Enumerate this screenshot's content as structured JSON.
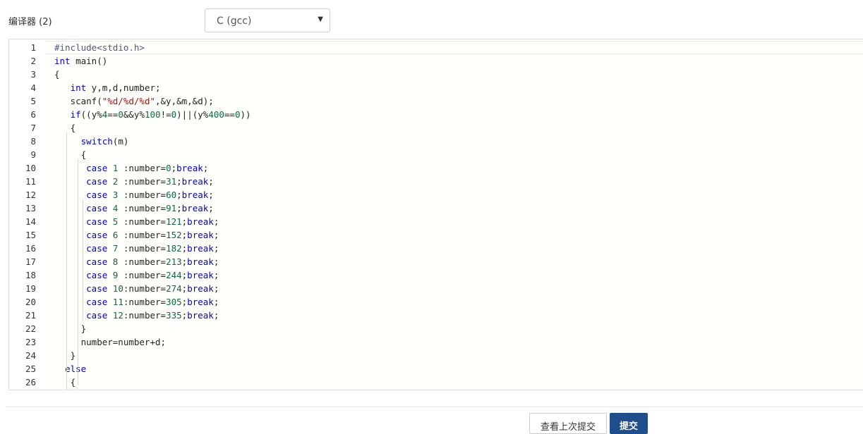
{
  "compiler": {
    "label": "编译器 (2)",
    "selected": "C (gcc)",
    "caret_icon": "triangle-down-icon"
  },
  "editor": {
    "lines": [
      {
        "n": "1",
        "tokens": [
          {
            "t": "#include<stdio.h>",
            "c": "meta"
          }
        ]
      },
      {
        "n": "2",
        "tokens": [
          {
            "t": "int",
            "c": "kw"
          },
          {
            "t": " main()",
            "c": ""
          }
        ]
      },
      {
        "n": "3",
        "tokens": [
          {
            "t": "{",
            "c": ""
          }
        ]
      },
      {
        "n": "4",
        "tokens": [
          {
            "t": "   ",
            "c": ""
          },
          {
            "t": "int",
            "c": "kw"
          },
          {
            "t": " y,m,d,number;",
            "c": ""
          }
        ]
      },
      {
        "n": "5",
        "tokens": [
          {
            "t": "   scanf(",
            "c": ""
          },
          {
            "t": "\"%d/%d/%d\"",
            "c": "str"
          },
          {
            "t": ",&y,&m,&d);",
            "c": ""
          }
        ]
      },
      {
        "n": "6",
        "tokens": [
          {
            "t": "   ",
            "c": ""
          },
          {
            "t": "if",
            "c": "kw"
          },
          {
            "t": "((y%",
            "c": ""
          },
          {
            "t": "4",
            "c": "num"
          },
          {
            "t": "==",
            "c": ""
          },
          {
            "t": "0",
            "c": "num"
          },
          {
            "t": "&&y%",
            "c": ""
          },
          {
            "t": "100",
            "c": "num"
          },
          {
            "t": "!=",
            "c": ""
          },
          {
            "t": "0",
            "c": "num"
          },
          {
            "t": ")||(y%",
            "c": ""
          },
          {
            "t": "400",
            "c": "num"
          },
          {
            "t": "==",
            "c": ""
          },
          {
            "t": "0",
            "c": "num"
          },
          {
            "t": "))",
            "c": ""
          }
        ]
      },
      {
        "n": "7",
        "tokens": [
          {
            "t": "   {",
            "c": ""
          }
        ]
      },
      {
        "n": "8",
        "tokens": [
          {
            "t": "     ",
            "c": ""
          },
          {
            "t": "switch",
            "c": "kw"
          },
          {
            "t": "(m)",
            "c": ""
          }
        ]
      },
      {
        "n": "9",
        "tokens": [
          {
            "t": "     {",
            "c": ""
          }
        ]
      },
      {
        "n": "10",
        "tokens": [
          {
            "t": "      ",
            "c": ""
          },
          {
            "t": "case",
            "c": "kw"
          },
          {
            "t": " ",
            "c": ""
          },
          {
            "t": "1",
            "c": "num"
          },
          {
            "t": " :number=",
            "c": ""
          },
          {
            "t": "0",
            "c": "num"
          },
          {
            "t": ";",
            "c": ""
          },
          {
            "t": "break",
            "c": "kw"
          },
          {
            "t": ";",
            "c": ""
          }
        ]
      },
      {
        "n": "11",
        "tokens": [
          {
            "t": "      ",
            "c": ""
          },
          {
            "t": "case",
            "c": "kw"
          },
          {
            "t": " ",
            "c": ""
          },
          {
            "t": "2",
            "c": "num"
          },
          {
            "t": " :number=",
            "c": ""
          },
          {
            "t": "31",
            "c": "num"
          },
          {
            "t": ";",
            "c": ""
          },
          {
            "t": "break",
            "c": "kw"
          },
          {
            "t": ";",
            "c": ""
          }
        ]
      },
      {
        "n": "12",
        "tokens": [
          {
            "t": "      ",
            "c": ""
          },
          {
            "t": "case",
            "c": "kw"
          },
          {
            "t": " ",
            "c": ""
          },
          {
            "t": "3",
            "c": "num"
          },
          {
            "t": " :number=",
            "c": ""
          },
          {
            "t": "60",
            "c": "num"
          },
          {
            "t": ";",
            "c": ""
          },
          {
            "t": "break",
            "c": "kw"
          },
          {
            "t": ";",
            "c": ""
          }
        ]
      },
      {
        "n": "13",
        "tokens": [
          {
            "t": "      ",
            "c": ""
          },
          {
            "t": "case",
            "c": "kw"
          },
          {
            "t": " ",
            "c": ""
          },
          {
            "t": "4",
            "c": "num"
          },
          {
            "t": " :number=",
            "c": ""
          },
          {
            "t": "91",
            "c": "num"
          },
          {
            "t": ";",
            "c": ""
          },
          {
            "t": "break",
            "c": "kw"
          },
          {
            "t": ";",
            "c": ""
          }
        ]
      },
      {
        "n": "14",
        "tokens": [
          {
            "t": "      ",
            "c": ""
          },
          {
            "t": "case",
            "c": "kw"
          },
          {
            "t": " ",
            "c": ""
          },
          {
            "t": "5",
            "c": "num"
          },
          {
            "t": " :number=",
            "c": ""
          },
          {
            "t": "121",
            "c": "num"
          },
          {
            "t": ";",
            "c": ""
          },
          {
            "t": "break",
            "c": "kw"
          },
          {
            "t": ";",
            "c": ""
          }
        ]
      },
      {
        "n": "15",
        "tokens": [
          {
            "t": "      ",
            "c": ""
          },
          {
            "t": "case",
            "c": "kw"
          },
          {
            "t": " ",
            "c": ""
          },
          {
            "t": "6",
            "c": "num"
          },
          {
            "t": " :number=",
            "c": ""
          },
          {
            "t": "152",
            "c": "num"
          },
          {
            "t": ";",
            "c": ""
          },
          {
            "t": "break",
            "c": "kw"
          },
          {
            "t": ";",
            "c": ""
          }
        ]
      },
      {
        "n": "16",
        "tokens": [
          {
            "t": "      ",
            "c": ""
          },
          {
            "t": "case",
            "c": "kw"
          },
          {
            "t": " ",
            "c": ""
          },
          {
            "t": "7",
            "c": "num"
          },
          {
            "t": " :number=",
            "c": ""
          },
          {
            "t": "182",
            "c": "num"
          },
          {
            "t": ";",
            "c": ""
          },
          {
            "t": "break",
            "c": "kw"
          },
          {
            "t": ";",
            "c": ""
          }
        ]
      },
      {
        "n": "17",
        "tokens": [
          {
            "t": "      ",
            "c": ""
          },
          {
            "t": "case",
            "c": "kw"
          },
          {
            "t": " ",
            "c": ""
          },
          {
            "t": "8",
            "c": "num"
          },
          {
            "t": " :number=",
            "c": ""
          },
          {
            "t": "213",
            "c": "num"
          },
          {
            "t": ";",
            "c": ""
          },
          {
            "t": "break",
            "c": "kw"
          },
          {
            "t": ";",
            "c": ""
          }
        ]
      },
      {
        "n": "18",
        "tokens": [
          {
            "t": "      ",
            "c": ""
          },
          {
            "t": "case",
            "c": "kw"
          },
          {
            "t": " ",
            "c": ""
          },
          {
            "t": "9",
            "c": "num"
          },
          {
            "t": " :number=",
            "c": ""
          },
          {
            "t": "244",
            "c": "num"
          },
          {
            "t": ";",
            "c": ""
          },
          {
            "t": "break",
            "c": "kw"
          },
          {
            "t": ";",
            "c": ""
          }
        ]
      },
      {
        "n": "19",
        "tokens": [
          {
            "t": "      ",
            "c": ""
          },
          {
            "t": "case",
            "c": "kw"
          },
          {
            "t": " ",
            "c": ""
          },
          {
            "t": "10",
            "c": "num"
          },
          {
            "t": ":number=",
            "c": ""
          },
          {
            "t": "274",
            "c": "num"
          },
          {
            "t": ";",
            "c": ""
          },
          {
            "t": "break",
            "c": "kw"
          },
          {
            "t": ";",
            "c": ""
          }
        ]
      },
      {
        "n": "20",
        "tokens": [
          {
            "t": "      ",
            "c": ""
          },
          {
            "t": "case",
            "c": "kw"
          },
          {
            "t": " ",
            "c": ""
          },
          {
            "t": "11",
            "c": "num"
          },
          {
            "t": ":number=",
            "c": ""
          },
          {
            "t": "305",
            "c": "num"
          },
          {
            "t": ";",
            "c": ""
          },
          {
            "t": "break",
            "c": "kw"
          },
          {
            "t": ";",
            "c": ""
          }
        ]
      },
      {
        "n": "21",
        "tokens": [
          {
            "t": "      ",
            "c": ""
          },
          {
            "t": "case",
            "c": "kw"
          },
          {
            "t": " ",
            "c": ""
          },
          {
            "t": "12",
            "c": "num"
          },
          {
            "t": ":number=",
            "c": ""
          },
          {
            "t": "335",
            "c": "num"
          },
          {
            "t": ";",
            "c": ""
          },
          {
            "t": "break",
            "c": "kw"
          },
          {
            "t": ";",
            "c": ""
          }
        ]
      },
      {
        "n": "22",
        "tokens": [
          {
            "t": "     }",
            "c": ""
          }
        ]
      },
      {
        "n": "23",
        "tokens": [
          {
            "t": "     number=number+d;",
            "c": ""
          }
        ]
      },
      {
        "n": "24",
        "tokens": [
          {
            "t": "   }",
            "c": ""
          }
        ]
      },
      {
        "n": "25",
        "tokens": [
          {
            "t": "  ",
            "c": ""
          },
          {
            "t": "else",
            "c": "kw"
          }
        ]
      },
      {
        "n": "26",
        "tokens": [
          {
            "t": "   {",
            "c": ""
          }
        ]
      }
    ]
  },
  "footer": {
    "prev_label": "查看上次提交",
    "submit_label": "提交"
  },
  "colors": {
    "keyword": "#0000cc",
    "number": "#116644",
    "string": "#aa1111",
    "submit_bg": "#1f4e8c"
  }
}
